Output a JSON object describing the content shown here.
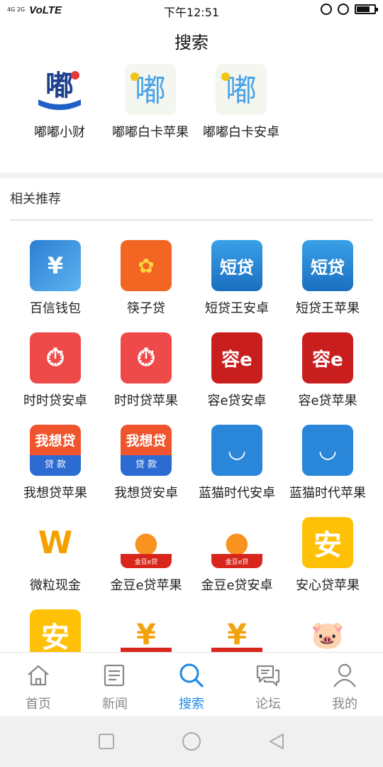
{
  "status_bar": {
    "signal_text": "4G 2G",
    "network": "VoLTE",
    "time": "下午12:51"
  },
  "header": {
    "title": "搜索"
  },
  "top_results": [
    {
      "label": "嘟嘟小财",
      "icon": "dudu-xiaocai-icon",
      "glyph": "嘟"
    },
    {
      "label": "嘟嘟白卡苹果",
      "icon": "dudu-baika-icon",
      "glyph": "嘟"
    },
    {
      "label": "嘟嘟白卡安卓",
      "icon": "dudu-baika-icon",
      "glyph": "嘟"
    }
  ],
  "recommend": {
    "title": "相关推荐",
    "items": [
      {
        "label": "百信钱包",
        "icon": "baixin-wallet-icon",
        "glyph": "¥",
        "style": "ic-bluecard"
      },
      {
        "label": "筷子贷",
        "icon": "kuaizi-dai-icon",
        "glyph": "✿",
        "style": "ic-orange"
      },
      {
        "label": "短贷王安卓",
        "icon": "duandai-icon",
        "glyph": "短贷",
        "style": "ic-duandai"
      },
      {
        "label": "短贷王苹果",
        "icon": "duandai-icon",
        "glyph": "短贷",
        "style": "ic-duandai"
      },
      {
        "label": "时时贷安卓",
        "icon": "shishi-dai-icon",
        "glyph": "⏱",
        "style": "ic-redclock"
      },
      {
        "label": "时时贷苹果",
        "icon": "shishi-dai-icon",
        "glyph": "⏱",
        "style": "ic-redclock"
      },
      {
        "label": "容e贷安卓",
        "icon": "rong-e-dai-icon",
        "glyph": "容e",
        "style": "ic-rong"
      },
      {
        "label": "容e贷苹果",
        "icon": "rong-e-dai-icon",
        "glyph": "容e",
        "style": "ic-rong"
      },
      {
        "label": "我想贷苹果",
        "icon": "woxiang-dai-icon",
        "glyph": "我想贷",
        "sub": "贷 款",
        "style": "ic-woxiang"
      },
      {
        "label": "我想贷安卓",
        "icon": "woxiang-dai-icon",
        "glyph": "我想贷",
        "sub": "贷 款",
        "style": "ic-woxiang"
      },
      {
        "label": "蓝猫时代安卓",
        "icon": "lanmao-icon",
        "glyph": "◡",
        "style": "ic-cat"
      },
      {
        "label": "蓝猫时代苹果",
        "icon": "lanmao-icon",
        "glyph": "◡",
        "style": "ic-cat"
      },
      {
        "label": "微粒现金",
        "icon": "weili-cash-icon",
        "glyph": "W",
        "style": "ic-wl"
      },
      {
        "label": "金豆e贷苹果",
        "icon": "jindou-mango-icon",
        "glyph": "●",
        "bar": "金豆e贷",
        "style": "ic-mango"
      },
      {
        "label": "金豆e贷安卓",
        "icon": "jindou-mango-icon",
        "glyph": "●",
        "bar": "金豆e贷",
        "style": "ic-mango"
      },
      {
        "label": "安心贷苹果",
        "icon": "anxin-dai-icon",
        "glyph": "安",
        "style": "ic-an"
      },
      {
        "label": "",
        "icon": "anxin-dai-icon",
        "glyph": "安",
        "style": "ic-an"
      },
      {
        "label": "",
        "icon": "money-bag-icon",
        "glyph": "¥",
        "style": "ic-bag"
      },
      {
        "label": "",
        "icon": "money-bag-icon",
        "glyph": "¥",
        "style": "ic-bag"
      },
      {
        "label": "",
        "icon": "piggy-bank-icon",
        "glyph": "🐷",
        "style": "ic-pig"
      }
    ]
  },
  "bottom_nav": [
    {
      "label": "首页",
      "icon": "home-icon",
      "active": false
    },
    {
      "label": "新闻",
      "icon": "news-icon",
      "active": false
    },
    {
      "label": "搜索",
      "icon": "search-icon",
      "active": true
    },
    {
      "label": "论坛",
      "icon": "forum-icon",
      "active": false
    },
    {
      "label": "我的",
      "icon": "profile-icon",
      "active": false
    }
  ],
  "colors": {
    "accent": "#1d8ae8",
    "inactive": "#888888"
  }
}
